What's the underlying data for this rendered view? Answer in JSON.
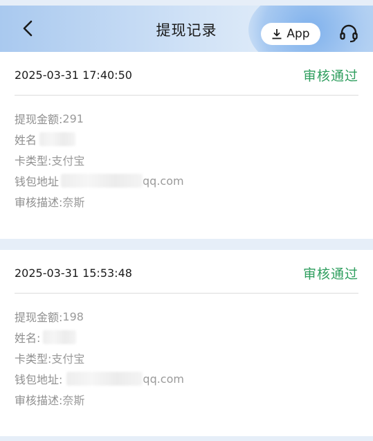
{
  "header": {
    "title": "提现记录",
    "app_label": "App",
    "icons": {
      "back": "chevron-left-icon",
      "download": "download-icon",
      "support": "headset-icon"
    }
  },
  "records": [
    {
      "time": "2025-03-31 17:40:50",
      "status": "审核通过",
      "amount_label": "提现金额:",
      "amount": "291",
      "name_label": "姓名",
      "card_type_label": "卡类型:",
      "card_type": "支付宝",
      "wallet_label": "钱包地址",
      "wallet_suffix": "qq.com",
      "desc_label": "审核描述:",
      "desc": "奈斯"
    },
    {
      "time": "2025-03-31 15:53:48",
      "status": "审核通过",
      "amount_label": "提现金额:",
      "amount": "198",
      "name_label": "姓名:",
      "card_type_label": "卡类型:",
      "card_type": "支付宝",
      "wallet_label": "钱包地址:",
      "wallet_suffix": "qq.com",
      "desc_label": "审核描述:",
      "desc": "奈斯"
    }
  ],
  "colors": {
    "status_green": "#2e9e5e",
    "page_bg": "#e6eef8"
  }
}
